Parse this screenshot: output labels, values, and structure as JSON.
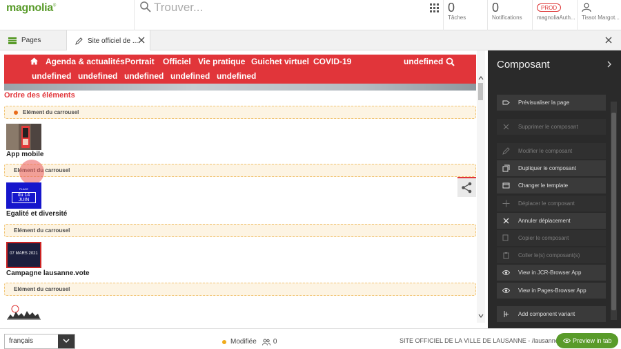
{
  "header": {
    "logo": "magnolia",
    "search_placeholder": "Trouver...",
    "tasks": {
      "count": "0",
      "label": "Tâches"
    },
    "notifications": {
      "count": "0",
      "label": "Notifications"
    },
    "environment": {
      "badge": "PROD",
      "label": "magnoliaAuth..."
    },
    "user": {
      "label": "Tissot Margot..."
    }
  },
  "tabs": {
    "pages": "Pages",
    "site": "Site officiel de ..."
  },
  "site_nav": {
    "row1": [
      "Agenda & actualités",
      "Portrait",
      "Officiel",
      "Vie pratique",
      "Guichet virtuel",
      "COVID-19",
      "undefined"
    ],
    "row2": [
      "undefined",
      "undefined",
      "undefined",
      "undefined",
      "undefined"
    ]
  },
  "editor": {
    "area_title": "Ordre des éléments",
    "carousel_label": "Elément du carrousel",
    "items": [
      {
        "title": "App mobile",
        "thumb": "app-mobile-image"
      },
      {
        "title": "Egalité et diversité",
        "thumb": "place-du-14-juin-image",
        "thumb_text_1": "PLACE",
        "thumb_text_2": "du 14 JUIN"
      },
      {
        "title": "Campagne lausanne.vote",
        "thumb": "07-mars-2021-image",
        "thumb_text_1": "07 MARS 2021"
      },
      {
        "title": "",
        "thumb": "lausanne-skyline-image"
      }
    ]
  },
  "panel": {
    "title": "Composant",
    "actions": [
      {
        "label": "Prévisualiser la page",
        "icon": "preview-icon",
        "enabled": true
      },
      {
        "label": "Supprimer le composant",
        "icon": "delete-icon",
        "enabled": false
      },
      {
        "label": "Modifier le composant",
        "icon": "edit-icon",
        "enabled": false
      },
      {
        "label": "Dupliquer le composant",
        "icon": "duplicate-icon",
        "enabled": true
      },
      {
        "label": "Changer le template",
        "icon": "template-icon",
        "enabled": true
      },
      {
        "label": "Déplacer le composant",
        "icon": "move-icon",
        "enabled": false
      },
      {
        "label": "Annuler déplacement",
        "icon": "cancel-move-icon",
        "enabled": true
      },
      {
        "label": "Copier le composant",
        "icon": "copy-icon",
        "enabled": false
      },
      {
        "label": "Coller le(s) composant(s)",
        "icon": "paste-icon",
        "enabled": false
      },
      {
        "label": "View in JCR-Browser App",
        "icon": "eye-icon",
        "enabled": true
      },
      {
        "label": "View in Pages-Browser App",
        "icon": "eye-icon",
        "enabled": true
      },
      {
        "label": "Add component variant",
        "icon": "add-variant-icon",
        "enabled": true
      }
    ]
  },
  "footer": {
    "language": "français",
    "status": "Modifiée",
    "users_count": "0",
    "site_path": "SITE OFFICIEL DE LA VILLE DE LAUSANNE - /lausanne",
    "preview_button": "Preview in tab"
  },
  "colors": {
    "brand_green": "#599b2a",
    "site_red": "#e1353a",
    "panel_dark": "#2a2a2a",
    "carousel_bg": "#fdf4e3",
    "status_dot": "#f0ab1a"
  }
}
